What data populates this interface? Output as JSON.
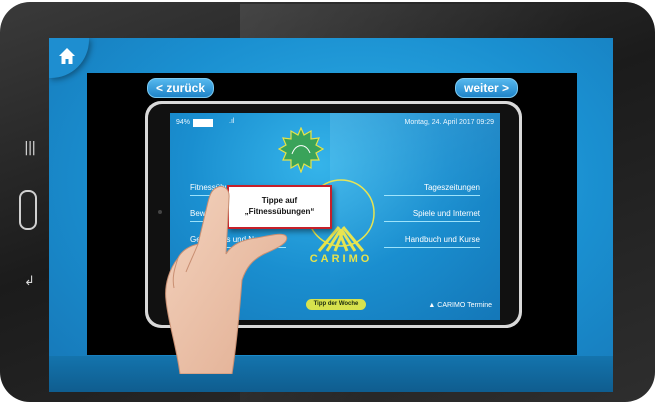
{
  "toolbar": {
    "home_icon": "home-icon"
  },
  "nav": {
    "back_label": "< zurück",
    "next_label": "weiter >"
  },
  "inner_status": {
    "battery": "94%",
    "datetime": "Montag, 24. April 2017   09:29"
  },
  "menu_left": [
    "Fitnessübungen",
    "Bewegungsübersicht",
    "Gedächtnis und Neues"
  ],
  "menu_right": [
    "Tageszeitungen",
    "Spiele und Internet",
    "Handbuch und Kurse"
  ],
  "logo": {
    "brand": "CARIMO"
  },
  "bottom": {
    "left_label": "CA",
    "tip_button": "Tipp der Woche",
    "termine": "▲  CARIMO Termine"
  },
  "callout": {
    "line1": "Tippe auf",
    "line2": "„Fitnessübungen“"
  },
  "colors": {
    "screen_blue": "#1a8fd0",
    "accent_yellow": "#d7e24d",
    "callout_border": "#c6202a"
  }
}
